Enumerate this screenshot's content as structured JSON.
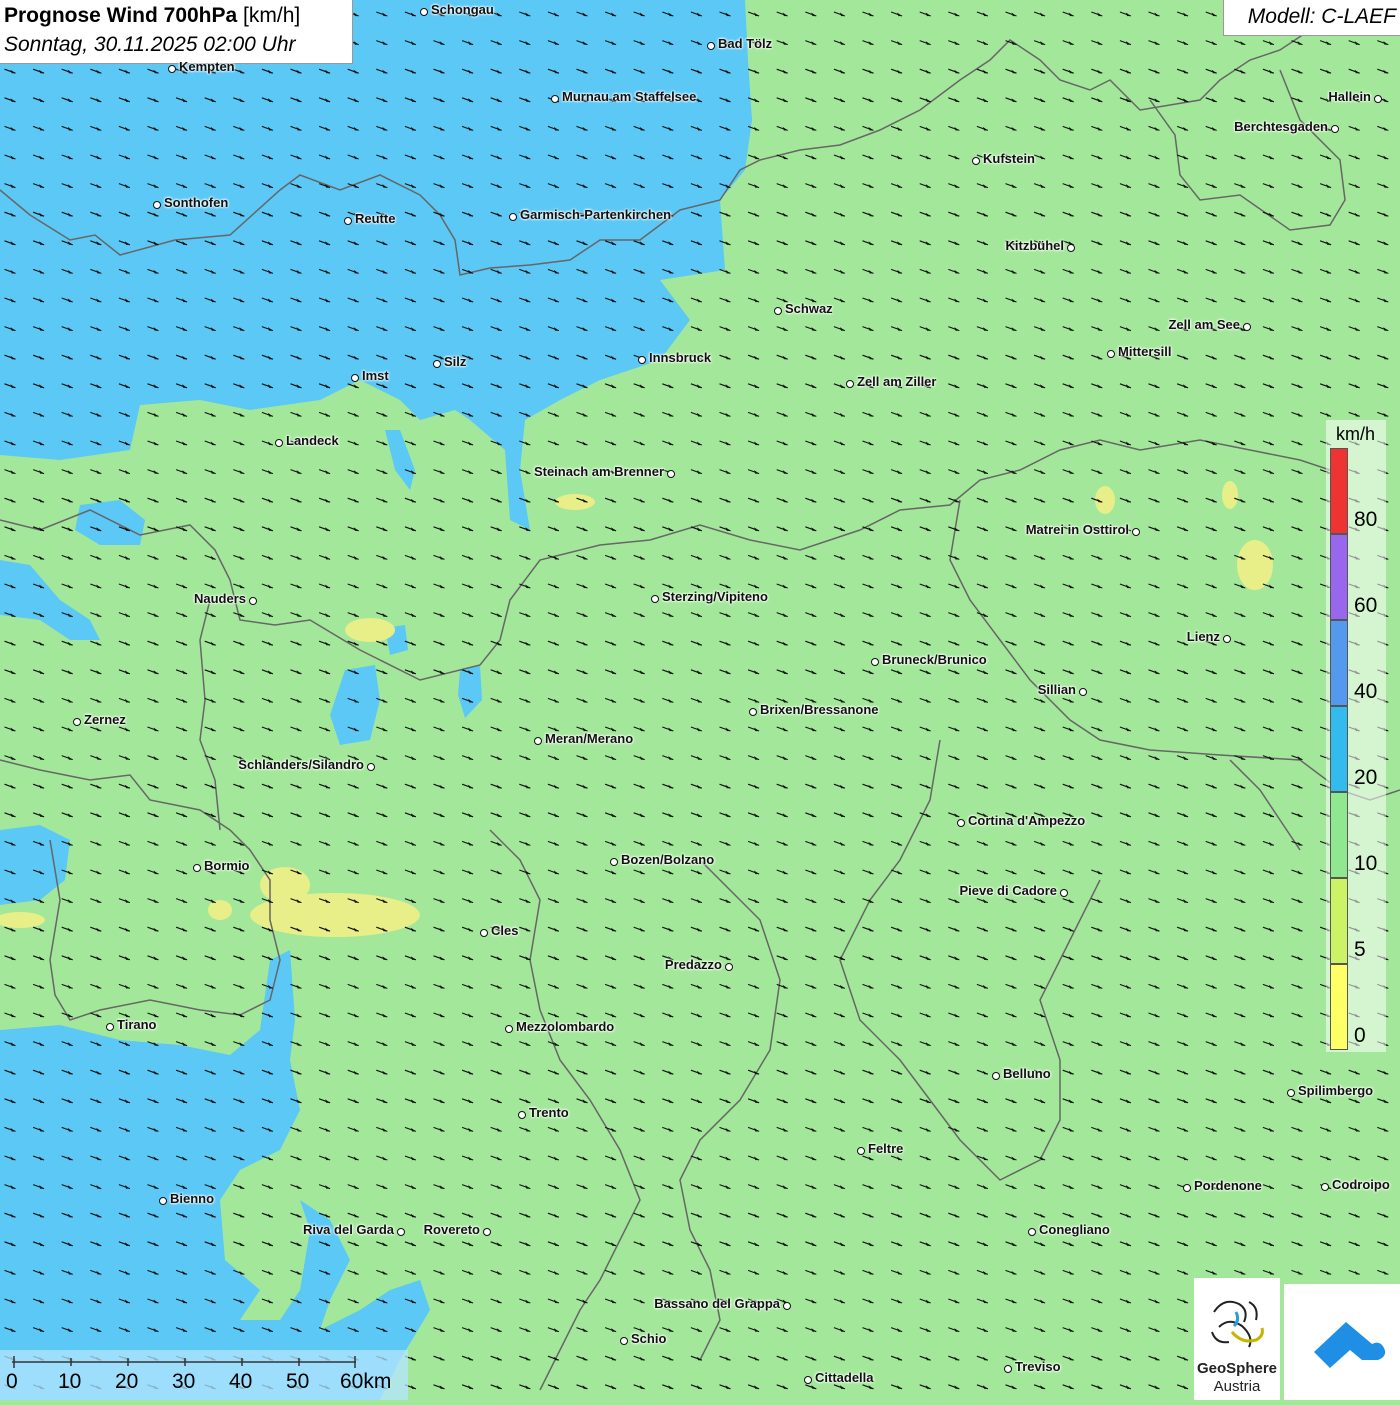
{
  "header": {
    "title_bold": "Prognose Wind 700hPa",
    "title_unit": "[km/h]",
    "datetime": "Sonntag, 30.11.2025 02:00 Uhr",
    "model": "Modell: C-LAEF"
  },
  "legend": {
    "unit": "km/h",
    "bands": [
      {
        "from": 0,
        "to": 5,
        "color": "#ffff66"
      },
      {
        "from": 5,
        "to": 10,
        "color": "#ccf266"
      },
      {
        "from": 10,
        "to": 20,
        "color": "#8fe88f"
      },
      {
        "from": 20,
        "to": 40,
        "color": "#33bbee"
      },
      {
        "from": 40,
        "to": 60,
        "color": "#5599ee"
      },
      {
        "from": 60,
        "to": 80,
        "color": "#9966ee"
      },
      {
        "from": 80,
        "to": 100,
        "color": "#ee3333"
      }
    ],
    "ticks": [
      "0",
      "5",
      "10",
      "20",
      "40",
      "60",
      "80"
    ]
  },
  "scale_bar": {
    "labels": [
      "0",
      "10",
      "20",
      "30",
      "40",
      "50",
      "60km"
    ]
  },
  "logos": {
    "geosphere_line1": "GeoSphere",
    "geosphere_line2": "Austria"
  },
  "colors": {
    "field_green": "#a3e89a",
    "field_blue": "#5bc8f5",
    "field_yellow": "#e8ee88",
    "border_gray": "#666666"
  },
  "cities": [
    {
      "name": "Schongau"
    },
    {
      "name": "Bad Tölz"
    },
    {
      "name": "Kempten"
    },
    {
      "name": "Murnau am Staffelsee"
    },
    {
      "name": "Hallein"
    },
    {
      "name": "Berchtesgaden"
    },
    {
      "name": "Kufstein"
    },
    {
      "name": "Sonthofen"
    },
    {
      "name": "Reutte"
    },
    {
      "name": "Garmisch-Partenkirchen"
    },
    {
      "name": "Kitzbühel"
    },
    {
      "name": "Schwaz"
    },
    {
      "name": "Zell am See"
    },
    {
      "name": "Mittersill"
    },
    {
      "name": "Innsbruck"
    },
    {
      "name": "Silz"
    },
    {
      "name": "Imst"
    },
    {
      "name": "Zell am Ziller"
    },
    {
      "name": "Landeck"
    },
    {
      "name": "Steinach am Brenner"
    },
    {
      "name": "Matrei in Osttirol"
    },
    {
      "name": "Nauders"
    },
    {
      "name": "Sterzing/Vipiteno"
    },
    {
      "name": "Lienz"
    },
    {
      "name": "Bruneck/Brunico"
    },
    {
      "name": "Sillian"
    },
    {
      "name": "Brixen/Bressanone"
    },
    {
      "name": "Zernez"
    },
    {
      "name": "Meran/Merano"
    },
    {
      "name": "Schlanders/Silandro"
    },
    {
      "name": "Cortina d'Ampezzo"
    },
    {
      "name": "Bozen/Bolzano"
    },
    {
      "name": "Bormio"
    },
    {
      "name": "Pieve di Cadore"
    },
    {
      "name": "Cles"
    },
    {
      "name": "Predazzo"
    },
    {
      "name": "Tirano"
    },
    {
      "name": "Mezzolombardo"
    },
    {
      "name": "Belluno"
    },
    {
      "name": "Spilimbergo"
    },
    {
      "name": "Trento"
    },
    {
      "name": "Feltre"
    },
    {
      "name": "Pordenone"
    },
    {
      "name": "Codroipo"
    },
    {
      "name": "Bienno"
    },
    {
      "name": "Riva del Garda"
    },
    {
      "name": "Rovereto"
    },
    {
      "name": "Conegliano"
    },
    {
      "name": "Bassano del Grappa"
    },
    {
      "name": "Schio"
    },
    {
      "name": "Treviso"
    },
    {
      "name": "Cittadella"
    }
  ]
}
